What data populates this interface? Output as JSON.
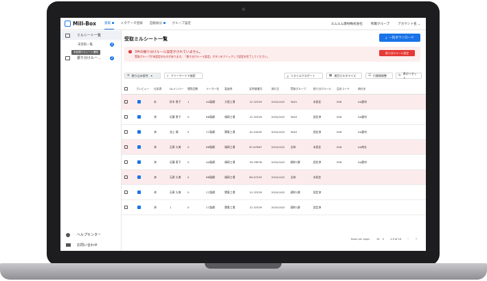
{
  "brand": {
    "name": "Mill-Box"
  },
  "nav": [
    {
      "label": "受取",
      "active": true,
      "dot": true
    },
    {
      "label": "メタデータ登録",
      "active": false,
      "dot": false
    },
    {
      "label": "自動振分",
      "active": false,
      "dot": true
    },
    {
      "label": "グループ設定",
      "active": false,
      "dot": false
    }
  ],
  "account": {
    "company": "エムエム建材株式会社",
    "group": "所属グループ",
    "user": "アカウント名 ⌄"
  },
  "sidebar": {
    "items": [
      {
        "label": "ミルシート一覧",
        "active": true
      },
      {
        "label": "振り分けルー…",
        "badge": "2"
      }
    ],
    "hidden_item": {
      "label": "未受取一覧",
      "badge": "4"
    },
    "tooltip": "未処理ミルシート通知",
    "footer": [
      {
        "label": "ヘルプセンター",
        "icon": "help-icon"
      },
      {
        "label": "お問い合わせ",
        "icon": "mail-icon"
      }
    ]
  },
  "page": {
    "title": "受取ミルシート一覧",
    "download_button": "一括ダウンロード"
  },
  "alert": {
    "title": "3件の振り分けルール設定がされていません。",
    "description": "受取グループが未設定のものがあります。「振り分けルール設定」ボタンをクリックして設定を完了してください。",
    "button": "振り分けルール設定"
  },
  "toolbar": {
    "filter": "絞り込み条件",
    "search": "フリーワードで検索",
    "export": "リストエクスポート",
    "customize": "項目カスタマイズ",
    "row_height": "行間隔調整",
    "reset": "表示リセット"
  },
  "table": {
    "columns": [
      "プレビュー",
      "仕訳表",
      "DLメンバー",
      "閲覧回数",
      "メーカー名",
      "製造所",
      "証明書番号",
      "発行日",
      "受取グループ",
      "振り分けルール",
      "品名コード",
      "商社名"
    ],
    "rows": [
      {
        "error": true,
        "shiwake": "未",
        "member": "鈴木 恵子",
        "views": "1",
        "maker": "AA製鋼",
        "plant": "大阪工場",
        "cert": "12-32329",
        "date": "2024/10/3",
        "group": "YA01",
        "rule": "未設定",
        "code": "056",
        "trader": "AA建材"
      },
      {
        "error": false,
        "shiwake": "済",
        "member": "近藤 恵子",
        "views": "0",
        "maker": "BB製鋼",
        "plant": "福岡工場",
        "cert": "12-32329",
        "date": "2024/10/3",
        "group": "YA03",
        "rule": "設定済",
        "code": "056",
        "trader": "AA建材"
      },
      {
        "error": false,
        "shiwake": "済",
        "member": "池上 晴",
        "views": "0",
        "maker": "CC製鋼",
        "plant": "関東工場",
        "cert": "34-34455",
        "date": "2024/10/3",
        "group": "YA03",
        "rule": "設定済",
        "code": "056",
        "trader": "AA建材"
      },
      {
        "error": true,
        "shiwake": "済",
        "member": "石原 久美",
        "views": "0",
        "maker": "BB製鋼",
        "plant": "福岡工場",
        "cert": "67-67667",
        "date": "2024/10/3",
        "group": "全体",
        "rule": "未設定",
        "code": "056",
        "trader": "AA商社"
      },
      {
        "error": false,
        "shiwake": "済",
        "member": "近藤 恵子",
        "views": "0",
        "maker": "AA製鋼",
        "plant": "福岡工場",
        "cert": "78-78978",
        "date": "2024/10/3",
        "group": "鋼材1課",
        "rule": "設定済",
        "code": "056",
        "trader": "AA建材"
      },
      {
        "error": true,
        "shiwake": "済",
        "member": "石原 久美",
        "views": "0",
        "maker": "BB製鋼",
        "plant": "福岡工場",
        "cert": "89-97293",
        "date": "2024/10/3",
        "group": "全体",
        "rule": "未設定",
        "code": "",
        "trader": ""
      },
      {
        "error": false,
        "shiwake": "済",
        "member": "石原 久美",
        "views": "0",
        "maker": "CC製鋼",
        "plant": "関東工場",
        "cert": "12-32329",
        "date": "2024/10/3",
        "group": "建材1課",
        "rule": "設定済",
        "code": "",
        "trader": ""
      },
      {
        "error": false,
        "shiwake": "済",
        "member": "1",
        "views": "0",
        "maker": "CC製鋼",
        "plant": "関東工場",
        "cert": "12-32329",
        "date": "2024/10/3",
        "group": "建材1課",
        "rule": "設定済",
        "code": "",
        "trader": ""
      }
    ]
  },
  "pagination": {
    "rows_per_page_label": "Rows per page:",
    "rows_per_page": "10",
    "range": "1-5 of 10"
  }
}
